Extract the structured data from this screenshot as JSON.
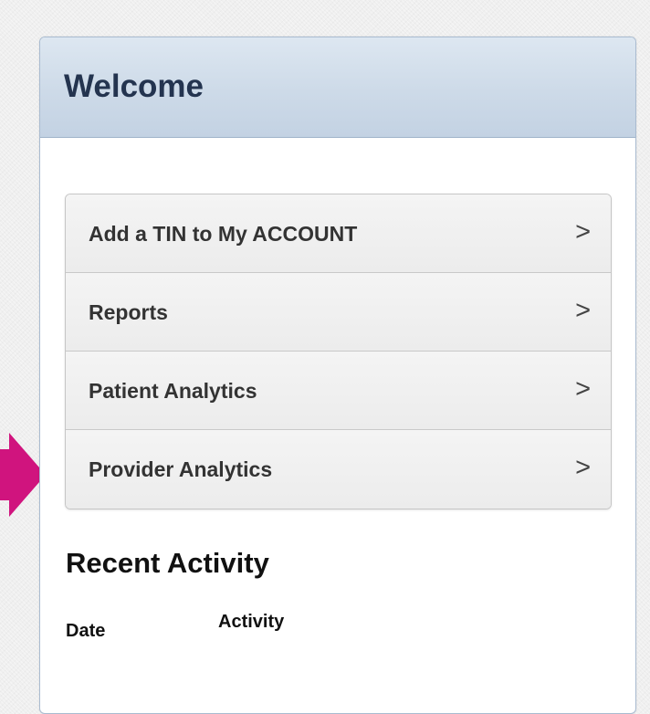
{
  "annotation": {
    "arrow_color": "#d0147e"
  },
  "panel": {
    "title": "Welcome",
    "header_text_color": "#24344f"
  },
  "menu": {
    "items": [
      {
        "label": "Add a TIN to My ACCOUNT",
        "chevron": ">"
      },
      {
        "label": "Reports",
        "chevron": ">"
      },
      {
        "label": "Patient Analytics",
        "chevron": ">"
      },
      {
        "label": "Provider Analytics",
        "chevron": ">"
      }
    ]
  },
  "recent_activity": {
    "title": "Recent Activity",
    "columns": {
      "date": "Date",
      "activity": "Activity"
    }
  }
}
